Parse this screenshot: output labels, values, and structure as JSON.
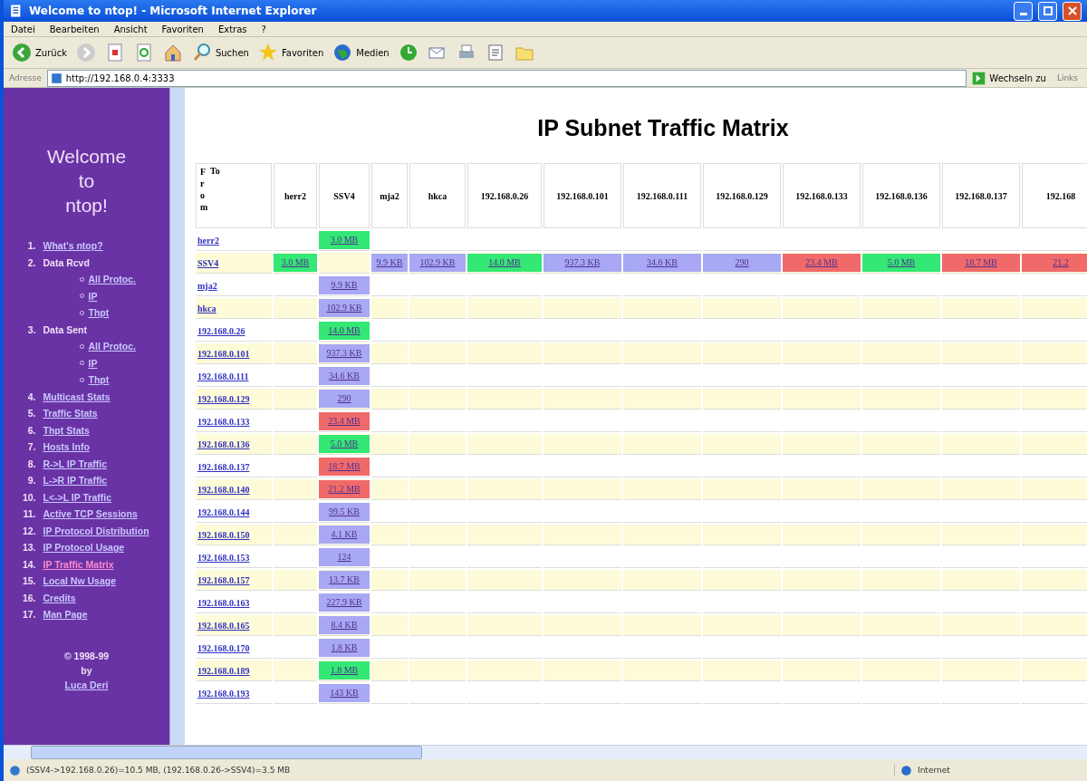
{
  "window": {
    "title": "Welcome to ntop! - Microsoft Internet Explorer"
  },
  "menu": [
    "Datei",
    "Bearbeiten",
    "Ansicht",
    "Favoriten",
    "Extras",
    "?"
  ],
  "toolbar": [
    {
      "kind": "back",
      "label": "Zurück"
    },
    {
      "kind": "forward"
    },
    {
      "kind": "stop"
    },
    {
      "kind": "refresh"
    },
    {
      "kind": "home"
    },
    {
      "kind": "search",
      "label": "Suchen"
    },
    {
      "kind": "favorites",
      "label": "Favoriten"
    },
    {
      "kind": "media",
      "label": "Medien"
    },
    {
      "kind": "history"
    },
    {
      "kind": "mail"
    },
    {
      "kind": "print"
    },
    {
      "kind": "edit"
    },
    {
      "kind": "folder"
    }
  ],
  "address": {
    "label": "Adresse",
    "value": "http://192.168.0.4:3333",
    "go": "Wechseln zu",
    "links": "Links"
  },
  "sidebar": {
    "title": "Welcome to ntop!",
    "items": [
      {
        "number": "1.",
        "label": "What's ntop?",
        "link": true,
        "selected": false
      },
      {
        "number": "2.",
        "label": "Data Rcvd",
        "link": false,
        "selected": false,
        "children": [
          {
            "label": "All Protoc.",
            "selected": false
          },
          {
            "label": "IP",
            "selected": false
          },
          {
            "label": "Thpt",
            "selected": false
          }
        ]
      },
      {
        "number": "3.",
        "label": "Data Sent",
        "link": false,
        "selected": false,
        "children": [
          {
            "label": "All Protoc.",
            "selected": false
          },
          {
            "label": "IP",
            "selected": false
          },
          {
            "label": "Thpt",
            "selected": false
          }
        ]
      },
      {
        "number": "4.",
        "label": "Multicast Stats",
        "link": true,
        "selected": false
      },
      {
        "number": "5.",
        "label": "Traffic Stats",
        "link": true,
        "selected": false
      },
      {
        "number": "6.",
        "label": "Thpt Stats",
        "link": true,
        "selected": false
      },
      {
        "number": "7.",
        "label": "Hosts Info",
        "link": true,
        "selected": false
      },
      {
        "number": "8.",
        "label": "R->L IP Traffic",
        "link": true,
        "selected": false
      },
      {
        "number": "9.",
        "label": "L->R IP Traffic",
        "link": true,
        "selected": false
      },
      {
        "number": "10.",
        "label": "L<->L IP Traffic",
        "link": true,
        "selected": false
      },
      {
        "number": "11.",
        "label": "Active TCP Sessions",
        "link": true,
        "selected": false
      },
      {
        "number": "12.",
        "label": "IP Protocol Distribution",
        "link": true,
        "selected": false
      },
      {
        "number": "13.",
        "label": "IP Protocol Usage",
        "link": true,
        "selected": false
      },
      {
        "number": "14.",
        "label": "IP Traffic Matrix",
        "link": true,
        "selected": true
      },
      {
        "number": "15.",
        "label": "Local Nw Usage",
        "link": true,
        "selected": false
      },
      {
        "number": "16.",
        "label": "Credits",
        "link": true,
        "selected": false
      },
      {
        "number": "17.",
        "label": "Man Page",
        "link": true,
        "selected": false
      }
    ],
    "footer": {
      "copyright": "© 1998-99",
      "by": "by",
      "author": "Luca Deri"
    }
  },
  "page": {
    "heading": "IP Subnet Traffic Matrix"
  },
  "matrix": {
    "corner_to": "To",
    "corner_from": "From",
    "columns": [
      "herr2",
      "SSV4",
      "mja2",
      "hkca",
      "192.168.0.26",
      "192.168.0.101",
      "192.168.0.111",
      "192.168.0.129",
      "192.168.0.133",
      "192.168.0.136",
      "192.168.0.137",
      "192.168"
    ],
    "rows": [
      {
        "host": "herr2",
        "cells": [
          {
            "kind": "blank"
          },
          {
            "kind": "value",
            "text": "3.0 MB",
            "color": "#33e874"
          }
        ]
      },
      {
        "host": "SSV4",
        "cells": [
          {
            "kind": "value",
            "text": "3.0 MB",
            "color": "#33e874"
          },
          {
            "kind": "blank"
          },
          {
            "kind": "value",
            "text": "9.9 KB",
            "color": "#a8a8f4"
          },
          {
            "kind": "value",
            "text": "102.9 KB",
            "color": "#a8a8f4"
          },
          {
            "kind": "value",
            "text": "14.0 MB",
            "color": "#33e874"
          },
          {
            "kind": "value",
            "text": "937.3 KB",
            "color": "#a8a8f4"
          },
          {
            "kind": "value",
            "text": "34.6 KB",
            "color": "#a8a8f4"
          },
          {
            "kind": "value",
            "text": "290",
            "color": "#a8a8f4"
          },
          {
            "kind": "value",
            "text": "23.4 MB",
            "color": "#f06a6a"
          },
          {
            "kind": "value",
            "text": "5.0 MB",
            "color": "#33e874"
          },
          {
            "kind": "value",
            "text": "18.7 MB",
            "color": "#f06a6a"
          },
          {
            "kind": "value",
            "text": "21.2",
            "color": "#f06a6a"
          }
        ]
      },
      {
        "host": "mja2",
        "cells": [
          {
            "kind": "blank"
          },
          {
            "kind": "value",
            "text": "9.9 KB",
            "color": "#a8a8f4"
          }
        ]
      },
      {
        "host": "hkca",
        "cells": [
          {
            "kind": "blank"
          },
          {
            "kind": "value",
            "text": "102.9 KB",
            "color": "#a8a8f4"
          }
        ]
      },
      {
        "host": "192.168.0.26",
        "cells": [
          {
            "kind": "blank"
          },
          {
            "kind": "value",
            "text": "14.0 MB",
            "color": "#33e874"
          }
        ]
      },
      {
        "host": "192.168.0.101",
        "cells": [
          {
            "kind": "blank"
          },
          {
            "kind": "value",
            "text": "937.3 KB",
            "color": "#a8a8f4"
          }
        ]
      },
      {
        "host": "192.168.0.111",
        "cells": [
          {
            "kind": "blank"
          },
          {
            "kind": "value",
            "text": "34.6 KB",
            "color": "#a8a8f4"
          }
        ]
      },
      {
        "host": "192.168.0.129",
        "cells": [
          {
            "kind": "blank"
          },
          {
            "kind": "value",
            "text": "290",
            "color": "#a8a8f4"
          }
        ]
      },
      {
        "host": "192.168.0.133",
        "cells": [
          {
            "kind": "blank"
          },
          {
            "kind": "value",
            "text": "23.4 MB",
            "color": "#f06a6a"
          }
        ]
      },
      {
        "host": "192.168.0.136",
        "cells": [
          {
            "kind": "blank"
          },
          {
            "kind": "value",
            "text": "5.0 MB",
            "color": "#33e874"
          }
        ]
      },
      {
        "host": "192.168.0.137",
        "cells": [
          {
            "kind": "blank"
          },
          {
            "kind": "value",
            "text": "18.7 MB",
            "color": "#f06a6a"
          }
        ]
      },
      {
        "host": "192.168.0.140",
        "cells": [
          {
            "kind": "blank"
          },
          {
            "kind": "value",
            "text": "21.2 MB",
            "color": "#f06a6a"
          }
        ]
      },
      {
        "host": "192.168.0.144",
        "cells": [
          {
            "kind": "blank"
          },
          {
            "kind": "value",
            "text": "99.5 KB",
            "color": "#a8a8f4"
          }
        ]
      },
      {
        "host": "192.168.0.150",
        "cells": [
          {
            "kind": "blank"
          },
          {
            "kind": "value",
            "text": "4.1 KB",
            "color": "#a8a8f4"
          }
        ]
      },
      {
        "host": "192.168.0.153",
        "cells": [
          {
            "kind": "blank"
          },
          {
            "kind": "value",
            "text": "124",
            "color": "#a8a8f4"
          }
        ]
      },
      {
        "host": "192.168.0.157",
        "cells": [
          {
            "kind": "blank"
          },
          {
            "kind": "value",
            "text": "13.7 KB",
            "color": "#a8a8f4"
          }
        ]
      },
      {
        "host": "192.168.0.163",
        "cells": [
          {
            "kind": "blank"
          },
          {
            "kind": "value",
            "text": "227.9 KB",
            "color": "#a8a8f4"
          }
        ]
      },
      {
        "host": "192.168.0.165",
        "cells": [
          {
            "kind": "blank"
          },
          {
            "kind": "value",
            "text": "8.4 KB",
            "color": "#a8a8f4"
          }
        ]
      },
      {
        "host": "192.168.0.170",
        "cells": [
          {
            "kind": "blank"
          },
          {
            "kind": "value",
            "text": "1.8 KB",
            "color": "#a8a8f4"
          }
        ]
      },
      {
        "host": "192.168.0.189",
        "cells": [
          {
            "kind": "blank"
          },
          {
            "kind": "value",
            "text": "1.8 MB",
            "color": "#33e874"
          }
        ]
      },
      {
        "host": "192.168.0.193",
        "cells": [
          {
            "kind": "blank"
          },
          {
            "kind": "value",
            "text": "143 KB",
            "color": "#a8a8f4"
          }
        ]
      }
    ]
  },
  "status_bar": {
    "text": "(SSV4->192.168.0.26)=10.5 MB, (192.168.0.26->SSV4)=3.5 MB",
    "zone": "Internet"
  }
}
